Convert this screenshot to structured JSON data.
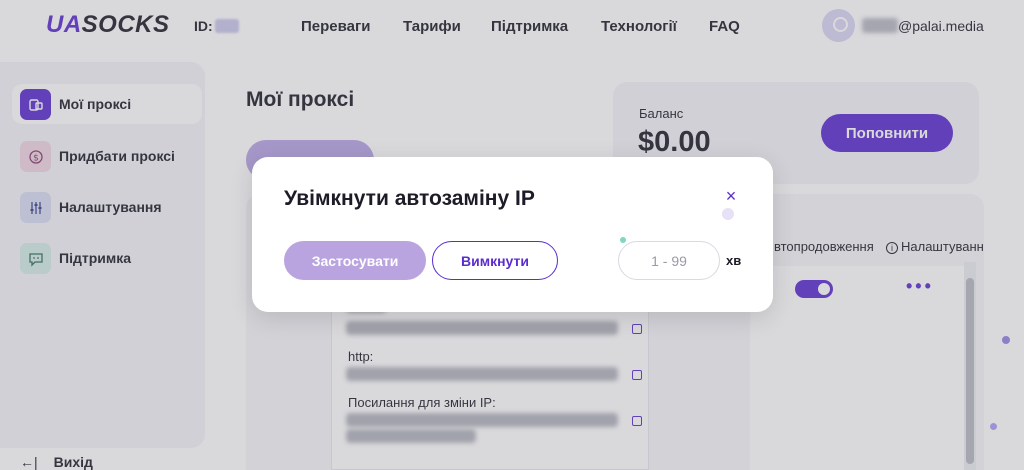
{
  "header": {
    "logo_prefix": "UA",
    "logo_suffix": "SOCKS",
    "id_label": "ID:",
    "nav": [
      "Переваги",
      "Тарифи",
      "Підтримка",
      "Технології",
      "FAQ"
    ],
    "email_domain": "@palai.media"
  },
  "sidebar": {
    "items": [
      {
        "label": "Мої проксі",
        "icon": "proxy-icon",
        "active": true
      },
      {
        "label": "Придбати проксі",
        "icon": "dollar-icon",
        "active": false
      },
      {
        "label": "Налаштування",
        "icon": "sliders-icon",
        "active": false
      },
      {
        "label": "Підтримка",
        "icon": "chat-icon",
        "active": false
      }
    ],
    "logout_arrow": "←|",
    "logout_label": "Вихід"
  },
  "main": {
    "page_title": "Мої проксі",
    "balance_label": "Баланс",
    "balance_value": "$0.00",
    "topup_button": "Поповнити",
    "columns": [
      "втопродовження",
      "Налаштуванн"
    ],
    "detail_labels": [
      "http:",
      "Посилання для зміни IP:"
    ]
  },
  "modal": {
    "title": "Увімкнути автозаміну IP",
    "apply_button": "Застосувати",
    "disable_button": "Вимкнути",
    "minutes_placeholder": "1 - 99",
    "minutes_value": "",
    "unit_label": "хв",
    "close_glyph": "×"
  },
  "colors": {
    "accent": "#5b2ccf",
    "accent_light": "#b9a4e0",
    "text": "#1c1c28",
    "panel": "#f3f3f7"
  }
}
